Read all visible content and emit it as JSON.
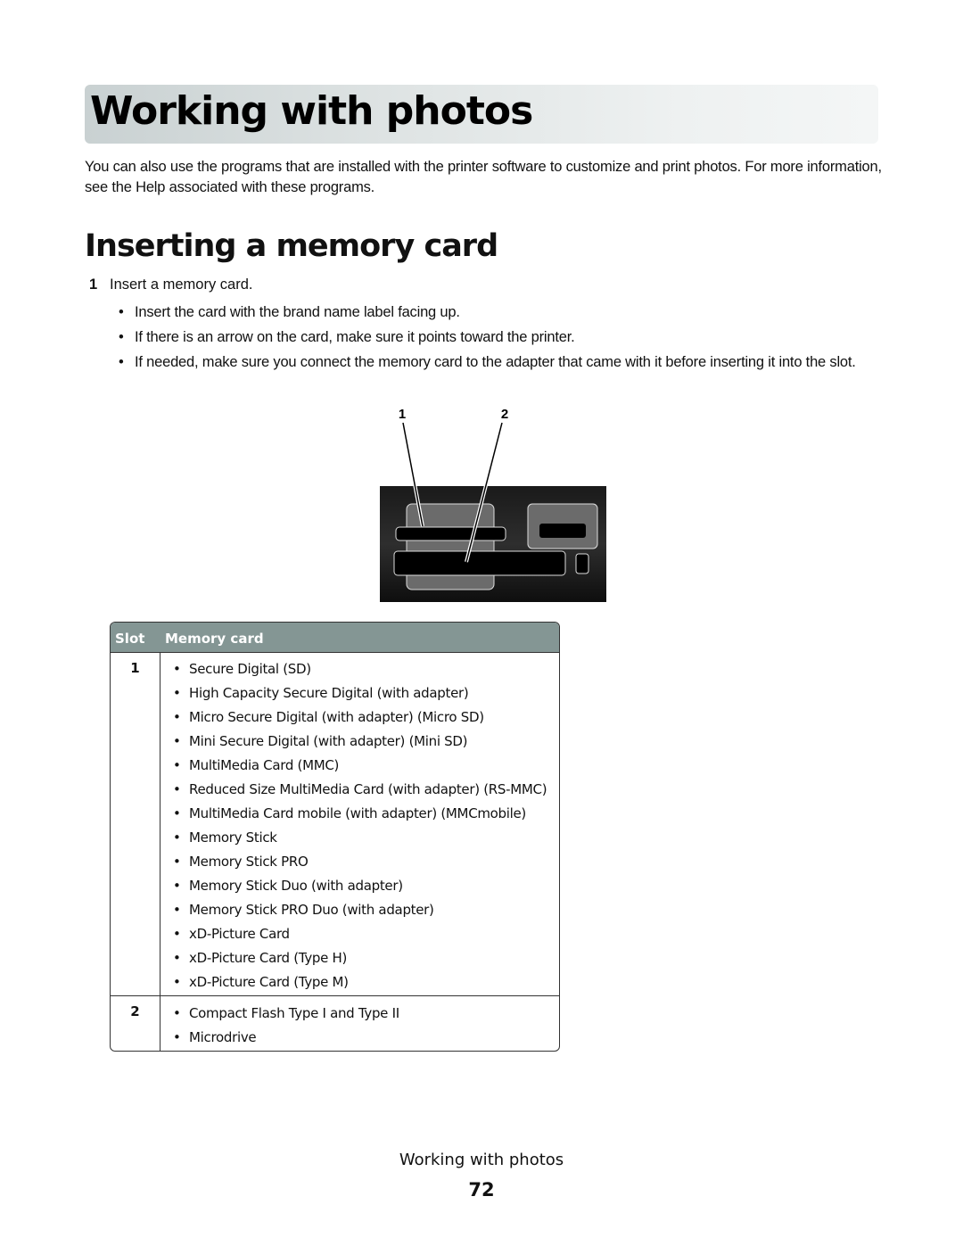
{
  "header": {
    "title": "Working with photos"
  },
  "intro": "You can also use the programs that are installed with the printer software to customize and print photos. For more information, see the Help associated with these programs.",
  "section": {
    "heading": "Inserting a memory card",
    "step": {
      "number": "1",
      "text": "Insert a memory card."
    },
    "bullets": [
      "Insert the card with the brand name label facing up.",
      "If there is an arrow on the card, make sure it points toward the printer.",
      "If needed, make sure you connect the memory card to the adapter that came with it before inserting it into the slot."
    ]
  },
  "figure": {
    "callouts": [
      "1",
      "2"
    ],
    "description": "memory-card-slots-illustration"
  },
  "table": {
    "headers": [
      "Slot",
      "Memory card"
    ],
    "rows": [
      {
        "slot": "1",
        "cards": [
          "Secure Digital (SD)",
          "High Capacity Secure Digital (with adapter)",
          "Micro Secure Digital (with adapter) (Micro SD)",
          "Mini Secure Digital (with adapter) (Mini SD)",
          "MultiMedia Card (MMC)",
          "Reduced Size MultiMedia Card (with adapter) (RS-MMC)",
          "MultiMedia Card mobile (with adapter) (MMCmobile)",
          "Memory Stick",
          "Memory Stick PRO",
          "Memory Stick Duo (with adapter)",
          "Memory Stick PRO Duo (with adapter)",
          "xD-Picture Card",
          "xD-Picture Card (Type H)",
          "xD-Picture Card (Type M)"
        ]
      },
      {
        "slot": "2",
        "cards": [
          "Compact Flash Type I and Type II",
          "Microdrive"
        ]
      }
    ]
  },
  "footer": {
    "title": "Working with photos",
    "page": "72"
  },
  "colors": {
    "table_header": "#849694",
    "title_bar_start": "#c9d1d2",
    "title_bar_end": "#f4f6f6"
  }
}
